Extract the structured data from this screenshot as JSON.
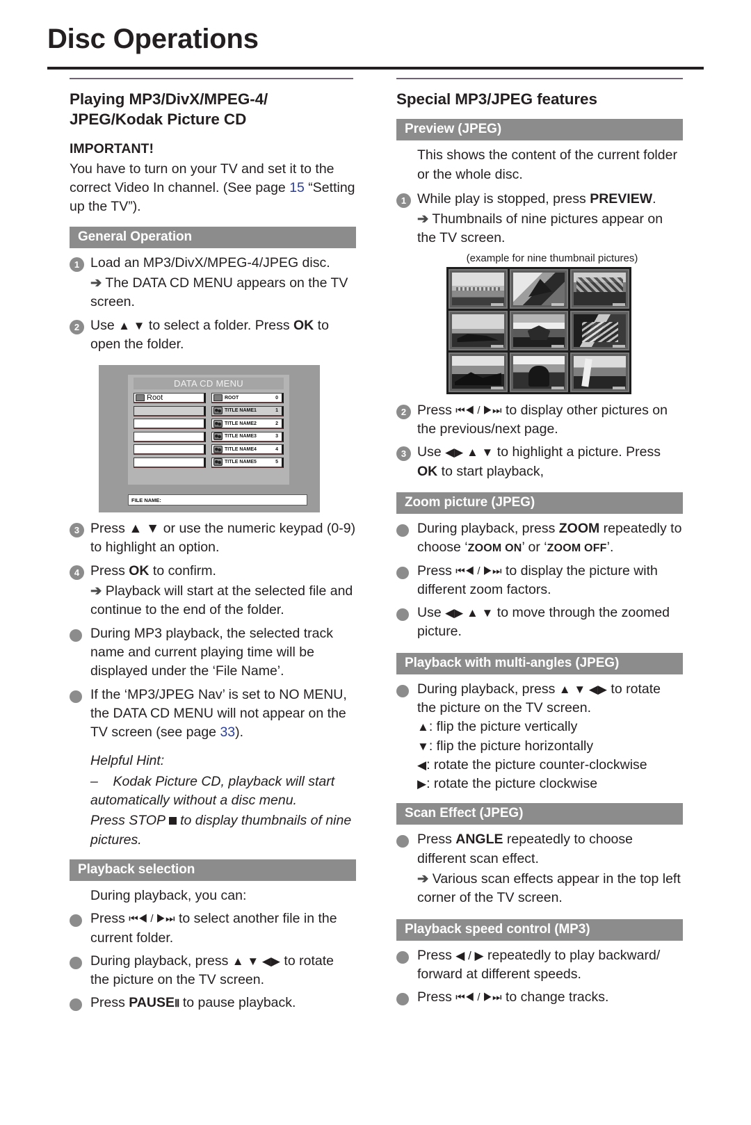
{
  "page": {
    "title": "Disc Operations"
  },
  "left": {
    "section_title": "Playing MP3/DivX/MPEG-4/\nJPEG/Kodak Picture CD",
    "important_heading": "IMPORTANT!",
    "important_text_a": "You have to turn on your TV and set it to the correct Video In channel.  (See page ",
    "important_page_ref": "15",
    "important_text_b": " “Setting up the TV”).",
    "general_operation_bar": "General Operation",
    "steps": [
      {
        "num": "1",
        "text": "Load an MP3/DivX/MPEG-4/JPEG disc.",
        "arrow_text": "The DATA CD MENU appears on the TV screen."
      },
      {
        "num": "2",
        "text_before": "Use ",
        "glyphs": "▲ ▼",
        "text_mid": " to select a folder.  Press ",
        "bold": "OK",
        "text_after": " to open the folder."
      },
      {
        "num": "3",
        "text": "Press ▲ ▼ or use the numeric keypad (0-9) to highlight an option."
      },
      {
        "num": "4",
        "text_before": "Press ",
        "bold": "OK",
        "text_after": " to confirm.",
        "arrow_text": "Playback will start at the selected file and continue to the end of the folder."
      }
    ],
    "bullets": [
      "During MP3 playback, the selected track name and current playing time will be displayed under the ‘File Name’.",
      "If the ‘MP3/JPEG Nav’ is set to NO MENU, the DATA CD MENU will not appear on the TV screen (see page "
    ],
    "nav_page_ref": "33",
    "nav_page_after": ").",
    "hint_title": "Helpful Hint:",
    "hint_dash": "–",
    "hint_line1": "Kodak Picture CD, playback will start automatically without a disc menu.",
    "hint_line2_a": "Press STOP ",
    "hint_line2_b": " to display thumbnails of nine pictures.",
    "playback_selection_bar": "Playback selection",
    "playback_intro": "During playback, you can:",
    "playback_bullets": [
      {
        "before": "Press ",
        "glyph": "⏮◀ / ▶⏭",
        "after": " to select another file in the current folder."
      },
      {
        "before": "During playback, press ",
        "glyph": "▲ ▼ ◀▶",
        "after": " to rotate the picture on the TV screen."
      },
      {
        "before": "Press ",
        "bold": "PAUSE",
        "glyph": "Ⅱ",
        "after": " to pause playback."
      }
    ],
    "cd_menu": {
      "title": "DATA CD MENU",
      "left_rows": [
        "Root",
        "",
        "",
        "",
        "",
        ""
      ],
      "right_rows": [
        {
          "label": "ROOT",
          "num": "0",
          "icon": "folder-icon",
          "highlight": false
        },
        {
          "label": "TITLE NAME1",
          "num": "1",
          "icon": "file-icon",
          "highlight": true
        },
        {
          "label": "TITLE NAME2",
          "num": "2",
          "icon": "file-icon",
          "highlight": false
        },
        {
          "label": "TITLE NAME3",
          "num": "3",
          "icon": "file-icon",
          "highlight": false
        },
        {
          "label": "TITLE NAME4",
          "num": "4",
          "icon": "file-icon",
          "highlight": false
        },
        {
          "label": "TITLE NAME5",
          "num": "5",
          "icon": "file-icon",
          "highlight": false
        }
      ],
      "file_name_label": "FILE NAME:"
    }
  },
  "right": {
    "section_title": "Special MP3/JPEG features",
    "preview_bar": "Preview (JPEG)",
    "preview_intro": "This shows the content of the current folder or the whole disc.",
    "preview_steps": [
      {
        "num": "1",
        "before": "While play is stopped, press ",
        "bold": "PREVIEW",
        "after": ".",
        "arrow_text": "Thumbnails of nine pictures appear on the TV screen."
      },
      {
        "num": "2",
        "before": "Press ",
        "glyph": "⏮◀ / ▶⏭",
        "after": " to display other pictures on the previous/next page."
      },
      {
        "num": "3",
        "before": "Use ",
        "glyph": "◀▶ ▲ ▼",
        "mid": " to highlight a picture. Press ",
        "bold": "OK",
        "after": " to start playback,"
      }
    ],
    "thumbnails_caption": "(example for nine thumbnail pictures)",
    "thumbnails_count": 9,
    "zoom_bar": "Zoom picture (JPEG)",
    "zoom_bullets": [
      {
        "before": "During playback, press ",
        "bold": "ZOOM",
        "mid": " repeatedly to choose ‘",
        "sc1": "ZOOM ON",
        "mid2": "’ or ‘",
        "sc2": "ZOOM OFF",
        "after": "’."
      },
      {
        "before": "Press ",
        "glyph": "⏮◀ / ▶⏭",
        "after": " to display the picture with different zoom factors."
      },
      {
        "before": "Use ",
        "glyph": "◀▶ ▲ ▼",
        "after": " to move through the zoomed picture."
      }
    ],
    "multiangle_bar": "Playback with multi-angles (JPEG)",
    "multiangle_main": {
      "before": "During playback, press ",
      "glyph": "▲ ▼ ◀▶",
      "after": " to rotate the picture on the TV screen."
    },
    "multiangle_lines": [
      {
        "glyph": "▲",
        "text": ": flip the picture vertically"
      },
      {
        "glyph": "▼",
        "text": ": flip the picture horizontally"
      },
      {
        "glyph": "◀",
        "text": ": rotate the picture counter-clockwise"
      },
      {
        "glyph": "▶",
        "text": ": rotate the picture clockwise"
      }
    ],
    "scan_bar": "Scan Effect (JPEG)",
    "scan_bullet": {
      "before": "Press ",
      "bold": "ANGLE",
      "after": " repeatedly to choose different scan effect.",
      "arrow_text": "Various scan effects appear in the top left corner of the TV screen."
    },
    "speed_bar": "Playback speed control (MP3)",
    "speed_bullets": [
      {
        "before": "Press ",
        "glyph": "◀ / ▶",
        "after": " repeatedly to play backward/ forward at different speeds."
      },
      {
        "before": "Press ",
        "glyph": "⏮◀ / ▶⏭",
        "after": " to change tracks."
      }
    ]
  },
  "colors": {
    "bar_gray": "#8c8c8c",
    "rule_purple": "#6f6472",
    "link_blue": "#2b3f9e",
    "text": "#231f20"
  }
}
